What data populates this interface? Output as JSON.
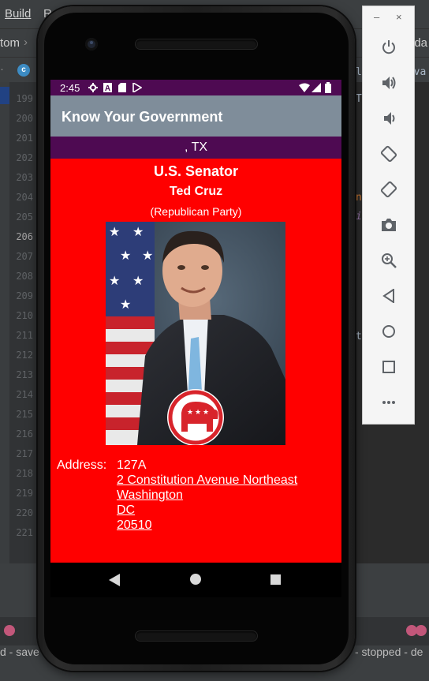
{
  "ide": {
    "menu": [
      "Build",
      "R"
    ],
    "nav_crumb": "tom",
    "nav_right": "lda",
    "line_numbers": [
      "199",
      "200",
      "201",
      "202",
      "203",
      "204",
      "205",
      "206",
      "207",
      "208",
      "209",
      "210",
      "211",
      "212",
      "213",
      "214",
      "215",
      "216",
      "217",
      "218",
      "219",
      "220",
      "221"
    ],
    "current_line": "206",
    "fragments": {
      "f1": "la",
      "f2": "java",
      "f3": "ers",
      "f4": "Toa",
      "f5": "nul",
      "f6": "ion",
      "f7": "ter"
    },
    "status_left": "d - save",
    "status_right": "- stopped - de"
  },
  "emulator_toolbar": {
    "minimize": "–",
    "close": "×",
    "buttons": [
      "power-icon",
      "volume-up-icon",
      "volume-down-icon",
      "rotate-left-icon",
      "rotate-right-icon",
      "camera-icon",
      "zoom-icon",
      "back-icon",
      "home-icon",
      "overview-icon",
      "more-icon"
    ]
  },
  "phone": {
    "status": {
      "time": "2:45"
    },
    "app_title": "Know Your Government",
    "location": ", TX",
    "official": {
      "office": "U.S. Senator",
      "name": "Ted Cruz",
      "party": "(Republican Party)",
      "address_label": "Address:",
      "address_lines": [
        "127A",
        "2 Constitution Avenue Northeast",
        "Washington",
        "DC",
        "20510"
      ]
    },
    "colors": {
      "background": "#ff0000",
      "status_bar": "#4e0a52",
      "app_bar": "#7f8d9a"
    }
  }
}
